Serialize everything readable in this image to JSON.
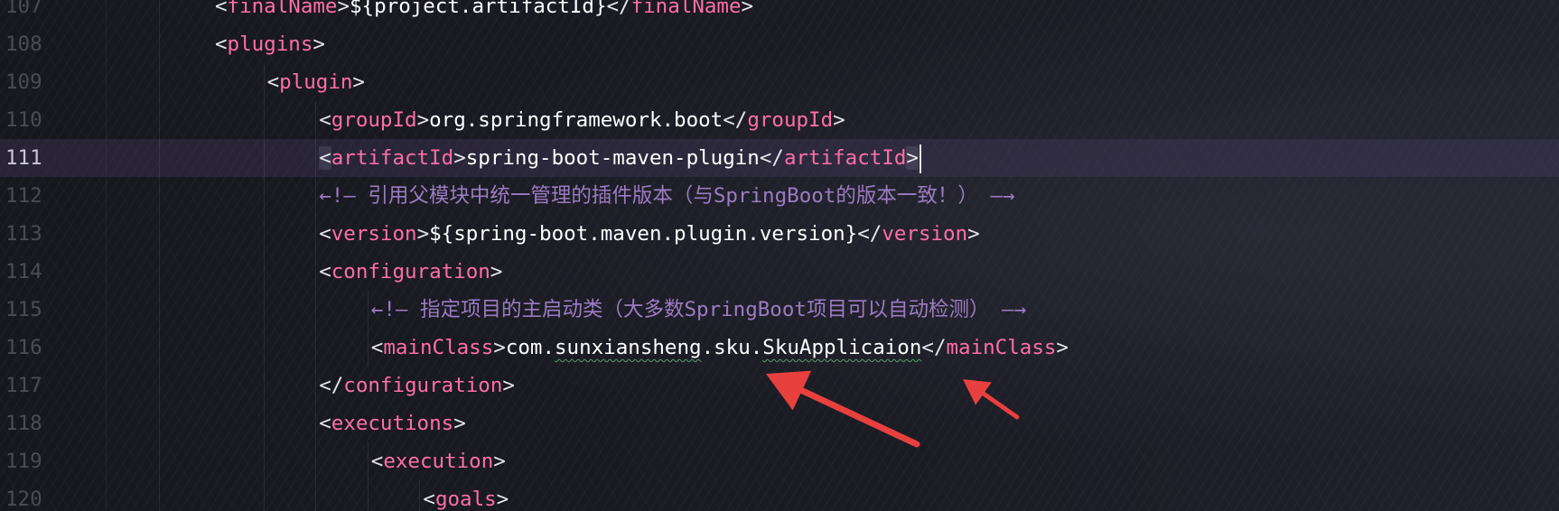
{
  "editor": {
    "current_line": "111",
    "lines": [
      {
        "number": "107",
        "indent": 2,
        "kind": "element",
        "tag": "finalName",
        "value": "${project.artifactId}"
      },
      {
        "number": "108",
        "indent": 2,
        "kind": "open",
        "tag": "plugins"
      },
      {
        "number": "109",
        "indent": 3,
        "kind": "open",
        "tag": "plugin"
      },
      {
        "number": "110",
        "indent": 4,
        "kind": "element",
        "tag": "groupId",
        "value": "org.springframework.boot"
      },
      {
        "number": "111",
        "indent": 4,
        "kind": "element",
        "tag": "artifactId",
        "value": "spring-boot-maven-plugin"
      },
      {
        "number": "112",
        "indent": 4,
        "kind": "comment",
        "open": "←!—",
        "text": " 引用父模块中统一管理的插件版本（与SpringBoot的版本一致！） ",
        "close": "—→"
      },
      {
        "number": "113",
        "indent": 4,
        "kind": "element",
        "tag": "version",
        "value": "${spring-boot.maven.plugin.version}"
      },
      {
        "number": "114",
        "indent": 4,
        "kind": "open",
        "tag": "configuration"
      },
      {
        "number": "115",
        "indent": 5,
        "kind": "comment",
        "open": "←!—",
        "text": " 指定项目的主启动类（大多数SpringBoot项目可以自动检测） ",
        "close": "—→"
      },
      {
        "number": "116",
        "indent": 5,
        "kind": "element",
        "tag": "mainClass",
        "value": "com.sunxiansheng.sku.SkuApplicaion"
      },
      {
        "number": "117",
        "indent": 4,
        "kind": "close",
        "tag": "configuration"
      },
      {
        "number": "118",
        "indent": 4,
        "kind": "open",
        "tag": "executions"
      },
      {
        "number": "119",
        "indent": 5,
        "kind": "open",
        "tag": "execution"
      },
      {
        "number": "120",
        "indent": 6,
        "kind": "open",
        "tag": "goals"
      }
    ],
    "colors": {
      "background": "#181820",
      "tag": "#ff6fa6",
      "text": "#ffffff",
      "comment": "#9b7cc2",
      "line_number": "#4a4b56",
      "current_line_number": "#c8c8d2",
      "annotation_arrow": "#e8403f",
      "spell_squiggle": "#55a06a"
    }
  },
  "annotations": {
    "arrows": [
      {
        "kind": "arrow",
        "color": "#e8403f",
        "points_to": "sunxiansheng"
      },
      {
        "kind": "arrow",
        "color": "#e8403f",
        "points_to": "SkuApplicaion"
      }
    ]
  }
}
